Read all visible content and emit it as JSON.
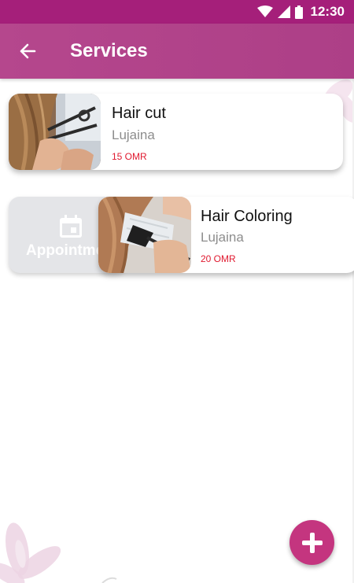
{
  "status_bar": {
    "time": "12:30",
    "icons": [
      "wifi-icon",
      "signal-icon",
      "battery-icon"
    ]
  },
  "app_bar": {
    "title": "Services",
    "back_icon": "arrow-back-icon"
  },
  "services": [
    {
      "title": "Hair cut",
      "provider": "Lujaina",
      "price": "15 OMR",
      "image": "haircut-photo"
    },
    {
      "title": "Hair Coloring",
      "provider": "Lujaina",
      "price": "20 OMR",
      "image": "hair-coloring-photo"
    }
  ],
  "swipe_action": {
    "label": "Appointment",
    "icon": "calendar-icon"
  },
  "fab": {
    "icon": "plus-icon"
  },
  "colors": {
    "status_bar": "#a51f7a",
    "app_bar": "#b5478d",
    "accent": "#c4357f",
    "price": "#e0192f"
  }
}
